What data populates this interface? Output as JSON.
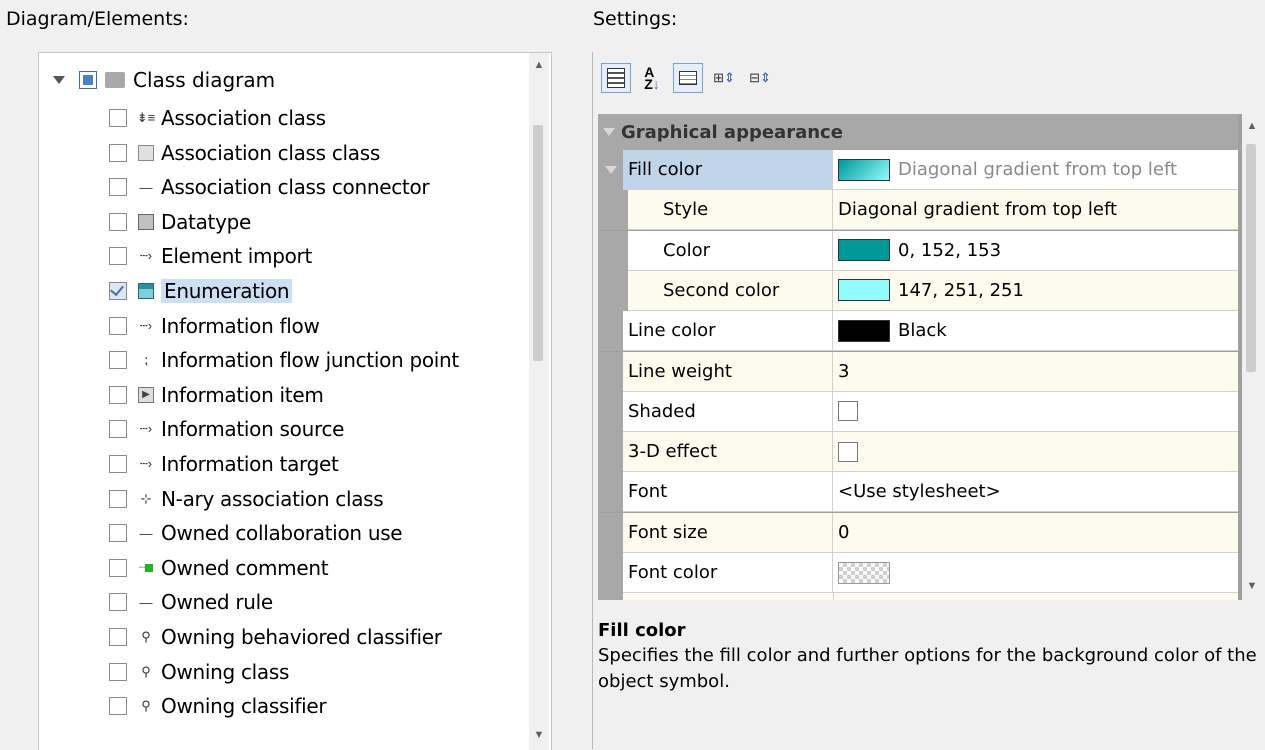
{
  "left_title": "Diagram/Elements:",
  "right_title": "Settings:",
  "tree": {
    "root_label": "Class diagram",
    "items": [
      {
        "label": "Association class",
        "icon": "association-class-icon",
        "glyph": "⇟≡",
        "checked": false
      },
      {
        "label": "Association class class",
        "icon": "class-box-icon",
        "glyph": "",
        "checked": false
      },
      {
        "label": "Association class connector",
        "icon": "connector-line-icon",
        "glyph": "—",
        "checked": false
      },
      {
        "label": "Datatype",
        "icon": "datatype-box-icon",
        "glyph": "",
        "checked": false
      },
      {
        "label": "Element import",
        "icon": "dashed-arrow-icon",
        "glyph": "┄›",
        "checked": false
      },
      {
        "label": "Enumeration",
        "icon": "enumeration-icon",
        "glyph": "",
        "checked": true
      },
      {
        "label": "Information flow",
        "icon": "dashed-arrow-icon",
        "glyph": "┄›",
        "checked": false
      },
      {
        "label": "Information flow junction point",
        "icon": "junction-point-icon",
        "glyph": "⁏",
        "checked": false
      },
      {
        "label": "Information item",
        "icon": "information-item-icon",
        "glyph": "▶",
        "checked": false
      },
      {
        "label": "Information source",
        "icon": "dashed-arrow-icon",
        "glyph": "┄›",
        "checked": false
      },
      {
        "label": "Information target",
        "icon": "dashed-arrow-icon",
        "glyph": "┄›",
        "checked": false
      },
      {
        "label": "N-ary association class",
        "icon": "nary-association-icon",
        "glyph": "⊹",
        "checked": false
      },
      {
        "label": "Owned collaboration use",
        "icon": "connector-line-icon",
        "glyph": "—",
        "checked": false
      },
      {
        "label": "Owned comment",
        "icon": "comment-link-icon",
        "glyph": "",
        "checked": false
      },
      {
        "label": "Owned rule",
        "icon": "connector-line-icon",
        "glyph": "—",
        "checked": false
      },
      {
        "label": "Owning behaviored classifier",
        "icon": "owner-pin-icon",
        "glyph": "⚲",
        "checked": false
      },
      {
        "label": "Owning class",
        "icon": "owner-pin-icon",
        "glyph": "⚲",
        "checked": false
      },
      {
        "label": "Owning classifier",
        "icon": "owner-pin-icon",
        "glyph": "⚲",
        "checked": false
      }
    ]
  },
  "toolbar": {
    "buttons": [
      "categorized-view-icon",
      "alphabetical-sort-icon",
      "property-pages-icon",
      "expand-all-icon",
      "collapse-all-icon"
    ]
  },
  "properties": {
    "section": "Graphical appearance",
    "rows": [
      {
        "name": "Fill color",
        "value": "Diagonal gradient from top left",
        "swatch": "gradient",
        "level": 0,
        "expandable": true,
        "selected": true,
        "muted": true
      },
      {
        "name": "Style",
        "value": "Diagonal gradient from top left",
        "level": 1
      },
      {
        "name": "Color",
        "value": "0, 152, 153",
        "swatch": "#009899",
        "level": 1
      },
      {
        "name": "Second color",
        "value": "147, 251, 251",
        "swatch": "#93fbfb",
        "level": 1
      },
      {
        "name": "Line color",
        "value": "Black",
        "swatch": "#000000",
        "level": 0
      },
      {
        "name": "Line weight",
        "value": "3",
        "level": 0
      },
      {
        "name": "Shaded",
        "value": "",
        "checkbox": true,
        "level": 0
      },
      {
        "name": "3-D effect",
        "value": "",
        "checkbox": true,
        "level": 0
      },
      {
        "name": "Font",
        "value": "<Use stylesheet>",
        "level": 0
      },
      {
        "name": "Font size",
        "value": "0",
        "level": 0
      },
      {
        "name": "Font color",
        "value": "",
        "swatch": "checker",
        "level": 0
      }
    ]
  },
  "description": {
    "title": "Fill color",
    "text": "Specifies the fill color and further options for the background color of the object symbol."
  }
}
